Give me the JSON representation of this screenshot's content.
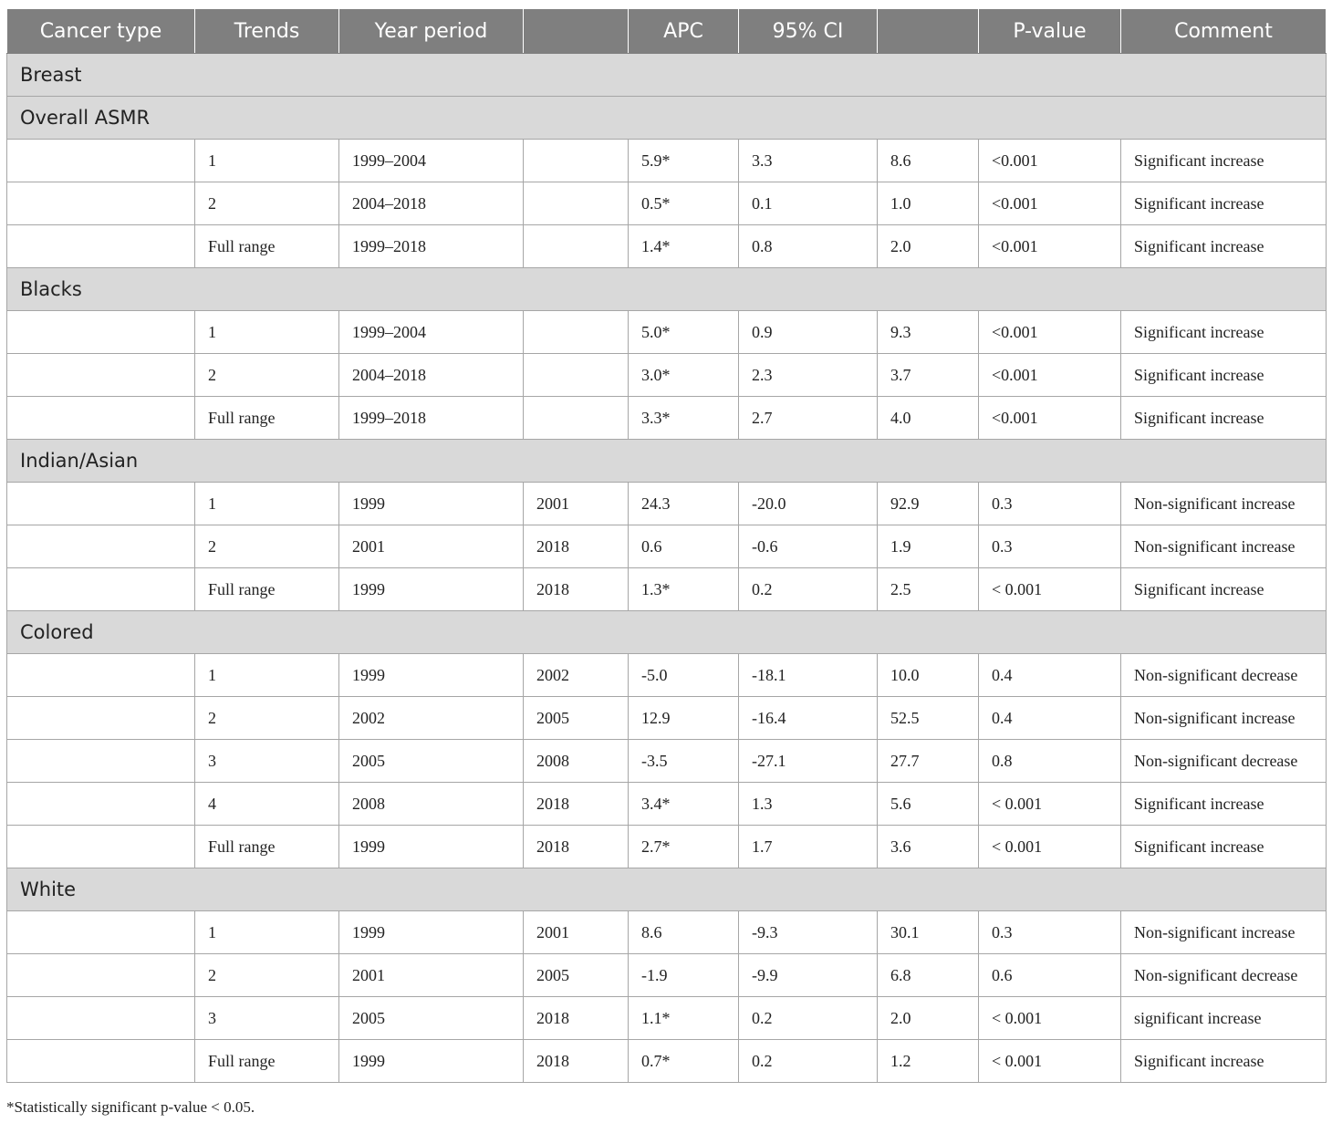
{
  "table": {
    "columns": [
      "Cancer type",
      "Trends",
      "Year period",
      "",
      "APC",
      "95% CI",
      "",
      "P-value",
      "Comment"
    ],
    "groups": [
      {
        "label": "Breast",
        "rows": []
      },
      {
        "label": "Overall ASMR",
        "rows": [
          [
            "",
            "1",
            "1999–2004",
            "",
            "5.9*",
            "3.3",
            "8.6",
            "<0.001",
            "Significant increase"
          ],
          [
            "",
            "2",
            "2004–2018",
            "",
            "0.5*",
            "0.1",
            "1.0",
            "<0.001",
            "Significant increase"
          ],
          [
            "",
            "Full range",
            "1999–2018",
            "",
            "1.4*",
            "0.8",
            "2.0",
            "<0.001",
            "Significant increase"
          ]
        ]
      },
      {
        "label": "Blacks",
        "rows": [
          [
            "",
            "1",
            "1999–2004",
            "",
            "5.0*",
            "0.9",
            "9.3",
            "<0.001",
            "Significant increase"
          ],
          [
            "",
            "2",
            "2004–2018",
            "",
            "3.0*",
            "2.3",
            "3.7",
            "<0.001",
            "Significant increase"
          ],
          [
            "",
            "Full range",
            "1999–2018",
            "",
            "3.3*",
            "2.7",
            "4.0",
            "<0.001",
            "Significant increase"
          ]
        ]
      },
      {
        "label": "Indian/Asian",
        "rows": [
          [
            "",
            "1",
            "1999",
            "2001",
            "24.3",
            "-20.0",
            "92.9",
            "0.3",
            "Non-significant increase"
          ],
          [
            "",
            "2",
            "2001",
            "2018",
            "0.6",
            "-0.6",
            "1.9",
            "0.3",
            "Non-significant increase"
          ],
          [
            "",
            "Full range",
            "1999",
            "2018",
            "1.3*",
            "0.2",
            "2.5",
            "< 0.001",
            "Significant increase"
          ]
        ]
      },
      {
        "label": "Colored",
        "rows": [
          [
            "",
            "1",
            "1999",
            "2002",
            "-5.0",
            "-18.1",
            "10.0",
            "0.4",
            "Non-significant decrease"
          ],
          [
            "",
            "2",
            "2002",
            "2005",
            "12.9",
            "-16.4",
            "52.5",
            "0.4",
            "Non-significant increase"
          ],
          [
            "",
            "3",
            "2005",
            "2008",
            "-3.5",
            "-27.1",
            "27.7",
            "0.8",
            "Non-significant decrease"
          ],
          [
            "",
            "4",
            "2008",
            "2018",
            "3.4*",
            "1.3",
            "5.6",
            "< 0.001",
            "Significant increase"
          ],
          [
            "",
            "Full range",
            "1999",
            "2018",
            "2.7*",
            "1.7",
            "3.6",
            "< 0.001",
            "Significant increase"
          ]
        ]
      },
      {
        "label": "White",
        "rows": [
          [
            "",
            "1",
            "1999",
            "2001",
            "8.6",
            "-9.3",
            "30.1",
            "0.3",
            "Non-significant increase"
          ],
          [
            "",
            "2",
            "2001",
            "2005",
            "-1.9",
            "-9.9",
            "6.8",
            "0.6",
            "Non-significant decrease"
          ],
          [
            "",
            "3",
            "2005",
            "2018",
            "1.1*",
            "0.2",
            "2.0",
            "< 0.001",
            "significant increase"
          ],
          [
            "",
            "Full range",
            "1999",
            "2018",
            "0.7*",
            "0.2",
            "1.2",
            "< 0.001",
            "Significant increase"
          ]
        ]
      }
    ]
  },
  "footnote": "*Statistically significant p-value < 0.05."
}
